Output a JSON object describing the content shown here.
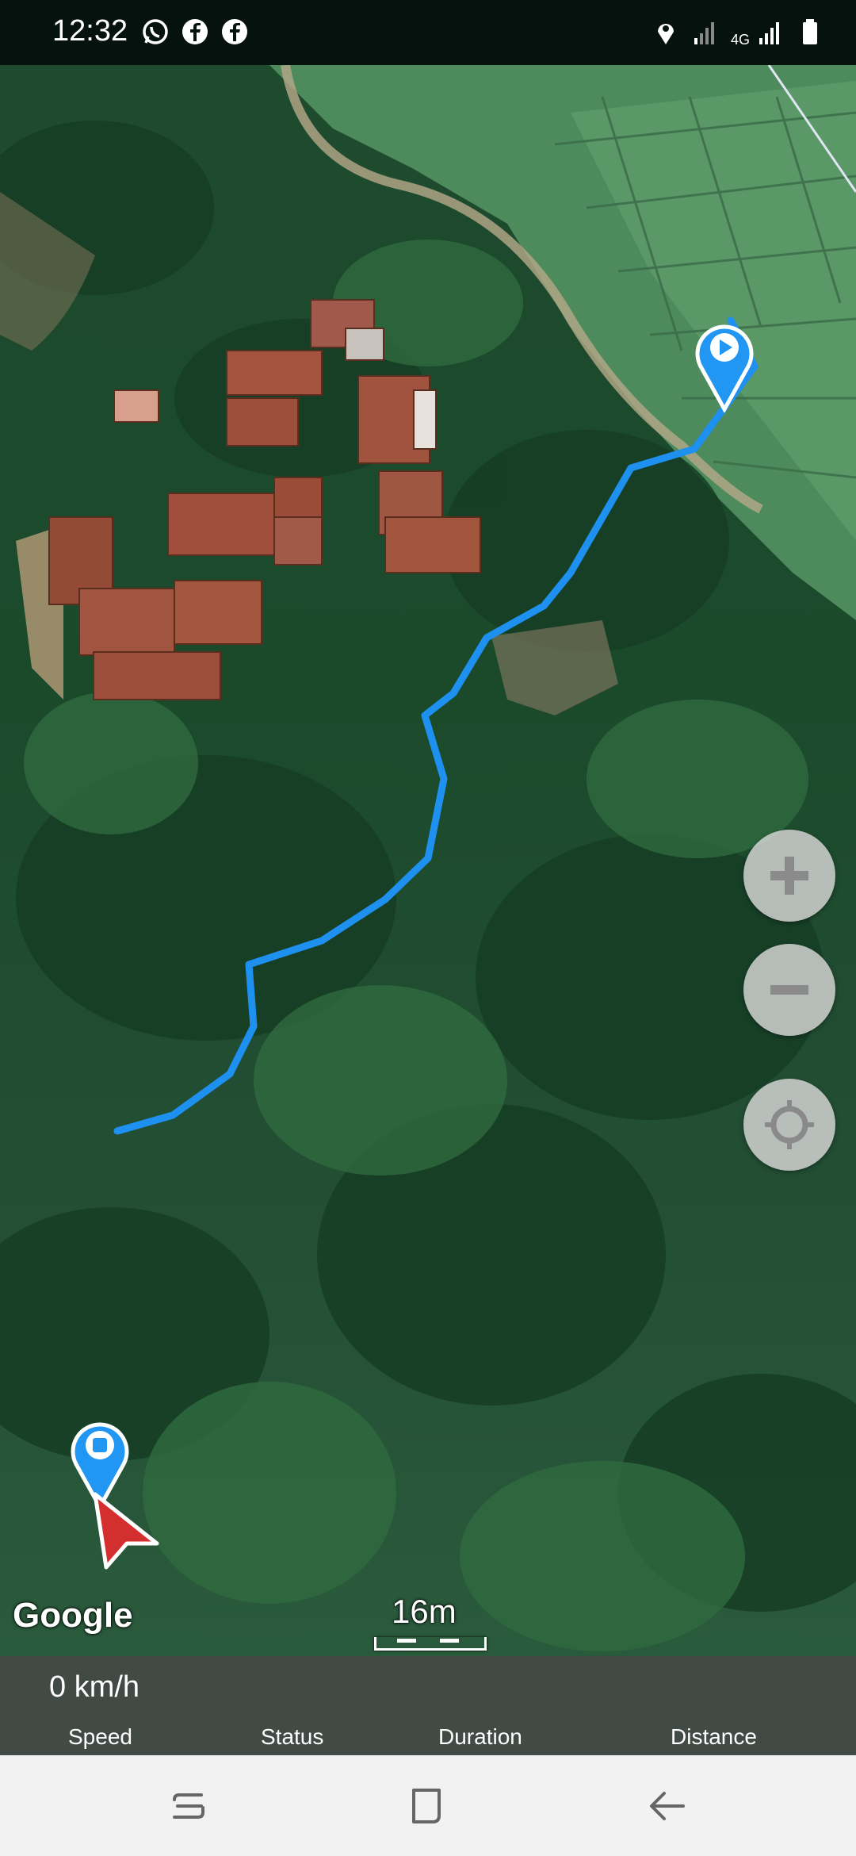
{
  "status_bar": {
    "time": "12:32",
    "left_icons": [
      "whatsapp-icon",
      "facebook-icon",
      "facebook-icon"
    ],
    "network_label": "4G",
    "right_icons": [
      "location-icon",
      "signal-icon",
      "signal-icon",
      "battery-icon"
    ]
  },
  "map": {
    "attribution": "Google",
    "scale_label": "16m",
    "route_color": "#1e90f0",
    "controls": [
      "zoom-in-icon",
      "zoom-out-icon",
      "my-location-icon"
    ],
    "markers": [
      "start-marker",
      "end-marker",
      "current-position-arrow"
    ]
  },
  "info_panel": {
    "speed_value": "0 km/h",
    "labels": {
      "speed": "Speed",
      "status": "Status",
      "duration": "Duration",
      "distance": "Distance"
    }
  },
  "nav_bar": {
    "buttons": [
      "recent-apps-icon",
      "home-icon",
      "back-icon"
    ]
  },
  "colors": {
    "accent": "#1e90f0",
    "marker": "#2196f3",
    "arrow": "#d32f2f"
  }
}
